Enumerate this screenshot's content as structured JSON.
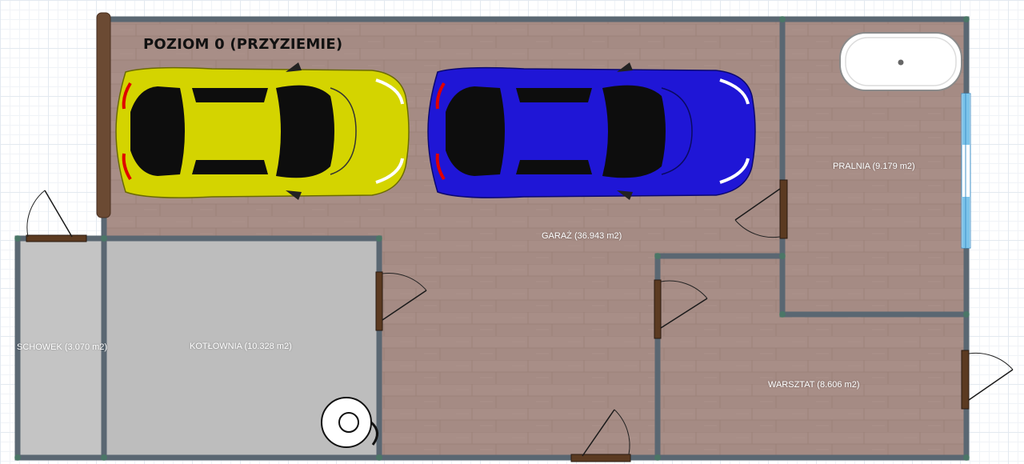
{
  "level_title": "POZIOM 0 (PRZYZIEMIE)",
  "rooms": [
    {
      "id": "garaz",
      "label": "GARAŻ (36.943 m2)",
      "floor": "wood"
    },
    {
      "id": "pralnia",
      "label": "PRALNIA (9.179 m2)",
      "floor": "wood"
    },
    {
      "id": "warsztat",
      "label": "WARSZTAT (8.606 m2)",
      "floor": "wood"
    },
    {
      "id": "kotlownia",
      "label": "KOTŁOWNIA (10.328 m2)",
      "floor": "concrete"
    },
    {
      "id": "schowek",
      "label": "SCHOWEK (3.070 m2)",
      "floor": "concrete"
    }
  ],
  "vehicles": [
    {
      "id": "car-yellow",
      "color": "#d4d400"
    },
    {
      "id": "car-blue",
      "color": "#1f16d6"
    }
  ],
  "colors": {
    "wall": "#5a6772",
    "wood_floor": "#a58b84",
    "concrete_floor": "#bdbdbd",
    "door": "#5b3a21",
    "window": "#7cc4ea"
  },
  "fixtures": [
    "bathtub",
    "boiler"
  ]
}
